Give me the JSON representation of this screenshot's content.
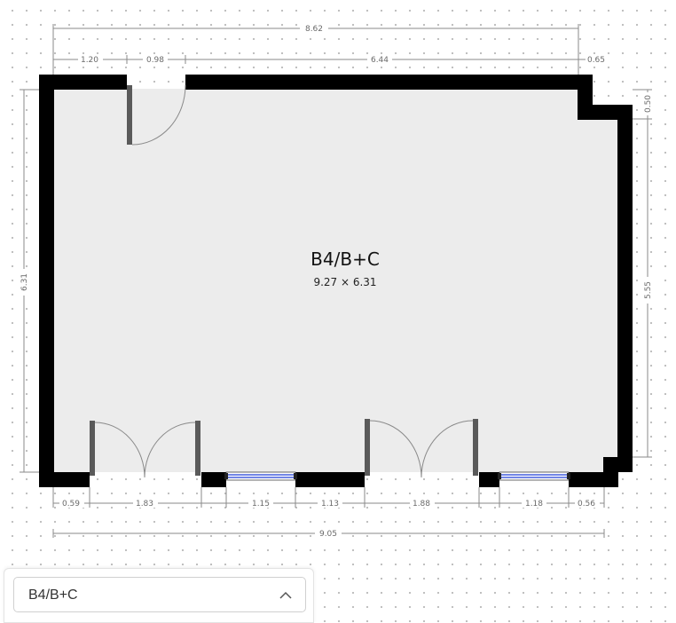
{
  "room": {
    "name": "B4/B+C",
    "size_label": "9.27 × 6.31"
  },
  "dimensions": {
    "top_overall": "8.62",
    "top_segments": [
      "1.20",
      "0.98",
      "6.44",
      "0.65"
    ],
    "left_height": "6.31",
    "right_upper": "0.50",
    "right_lower": "5.55",
    "bottom_segments": [
      "0.59",
      "1.83",
      "1.15",
      "1.13",
      "1.88",
      "1.18",
      "0.56"
    ],
    "bottom_overall": "9.05"
  },
  "room_selector": {
    "selected": "B4/B+C",
    "icon": "chevron-up-icon"
  },
  "colors": {
    "wall": "#000000",
    "floor": "#ececec",
    "window": "#1f3fd8",
    "door_leaf": "#5a5a5a"
  }
}
